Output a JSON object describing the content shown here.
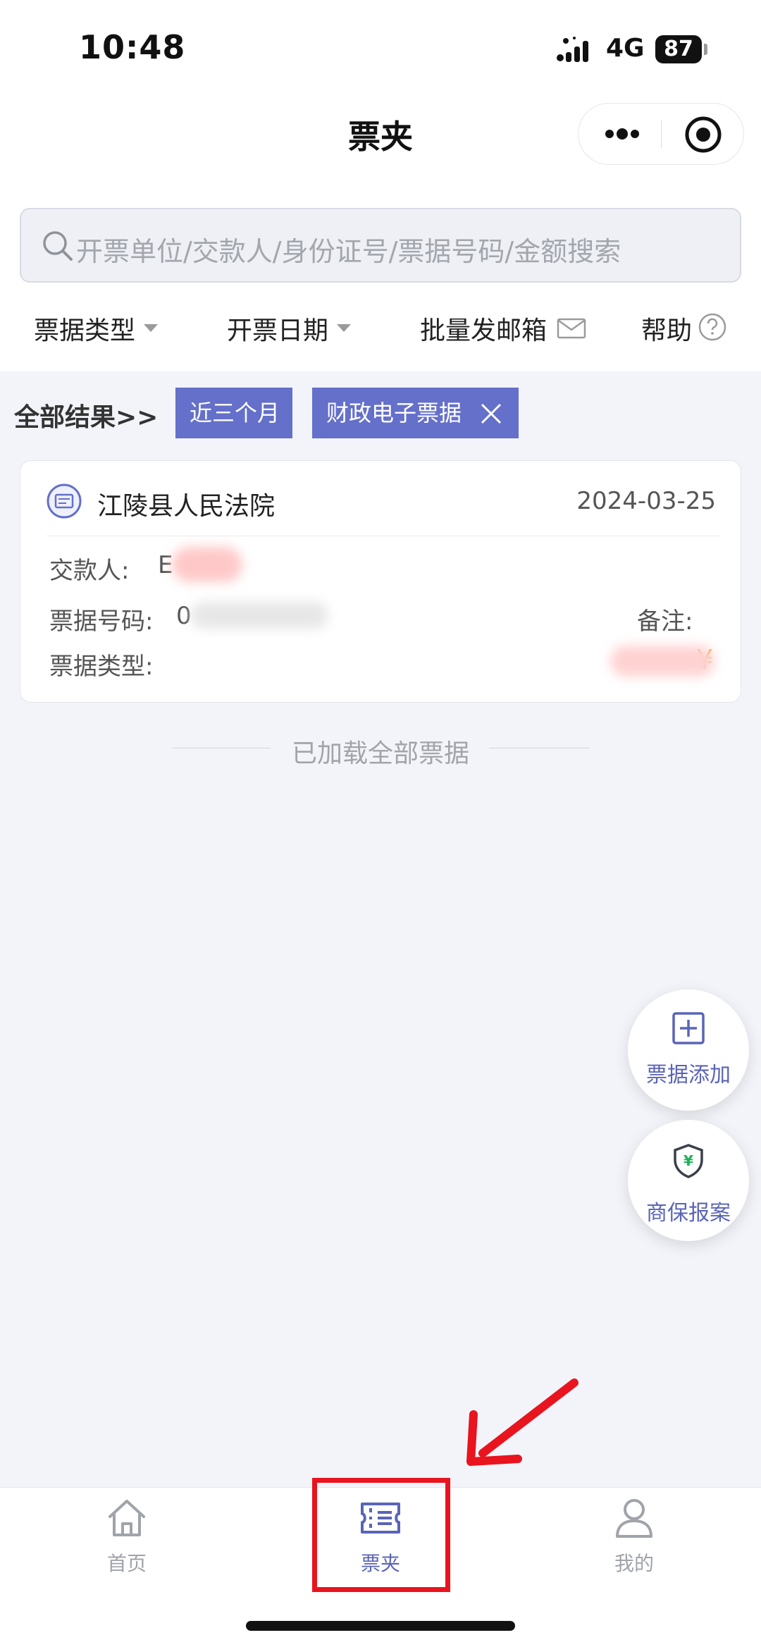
{
  "status_bar": {
    "time": "10:48",
    "network": "4G",
    "battery": "87"
  },
  "nav": {
    "title": "票夹"
  },
  "search": {
    "placeholder": "开票单位/交款人/身份证号/票据号码/金额搜索"
  },
  "filters": {
    "type": "票据类型",
    "date": "开票日期",
    "mail": "批量发邮箱",
    "help": "帮助"
  },
  "results": {
    "label": "全部结果>>",
    "chips": [
      "近三个月",
      "财政电子票据"
    ]
  },
  "card": {
    "title": "江陵县人民法院",
    "date": "2024-03-25",
    "payer_label": "交款人:",
    "payer_value_visible": "E",
    "number_label": "票据号码:",
    "number_value_visible": "0",
    "type_label": "票据类型:",
    "note_label": "备注:",
    "amount_prefix": "¥"
  },
  "list_end": {
    "text": "已加载全部票据"
  },
  "fabs": {
    "add_label": "票据添加",
    "report_label": "商保报案",
    "report_symbol": "¥"
  },
  "tabbar": {
    "items": [
      {
        "label": "首页",
        "active": false
      },
      {
        "label": "票夹",
        "active": true
      },
      {
        "label": "我的",
        "active": false
      }
    ]
  },
  "colors": {
    "accent": "#6470c9",
    "amount": "#f2a723",
    "annotation_red": "#e8141e",
    "inactive_tab": "#a0a3aa"
  }
}
